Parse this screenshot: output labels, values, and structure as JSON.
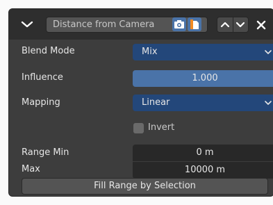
{
  "header": {
    "name_value": "Distance from Camera",
    "icons": [
      "chevron-down-icon",
      "camera-icon",
      "edit-mode-icon",
      "move-up-icon",
      "move-down-icon",
      "close-icon"
    ]
  },
  "fields": {
    "blend_mode_label": "Blend Mode",
    "blend_mode_value": "Mix",
    "influence_label": "Influence",
    "influence_value": "1.000",
    "mapping_label": "Mapping",
    "mapping_value": "Linear",
    "invert_label": "Invert",
    "invert_checked": false,
    "range_min_label": "Range Min",
    "range_min_value": "0 m",
    "max_label": "Max",
    "max_value": "10000 m"
  },
  "actions": {
    "fill_range_label": "Fill Range by Selection"
  },
  "colors": {
    "panel_bg": "#3d3d3d",
    "header_bg": "#2e2e2e",
    "accent_blue": "#4a73a8",
    "selected_dropdown": "#23477a"
  }
}
